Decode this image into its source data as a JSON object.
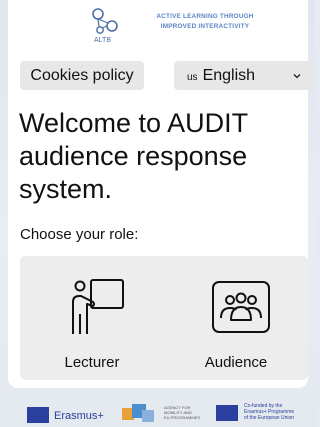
{
  "logo": {
    "alt": "ALTB",
    "tagline": [
      "ACTIVE LEARNING THROUGH",
      "IMPROVED INTERACTIVITY"
    ],
    "accent": "#5b84c4"
  },
  "controls": {
    "cookies_label": "Cookies policy",
    "language": {
      "code": "us",
      "selected": "English"
    }
  },
  "welcome": "Welcome to AUDIT audience response system.",
  "choose_role": "Choose your role:",
  "roles": [
    {
      "label": "Lecturer",
      "icon": "lecturer-board-icon"
    },
    {
      "label": "Audience",
      "icon": "audience-group-icon"
    }
  ],
  "footer": {
    "erasmus": "Erasmus+",
    "agency": [
      "AGENCY FOR",
      "MOBILITY AND",
      "EU PROGRAMMES"
    ],
    "cofunded": [
      "Co-funded by the",
      "Erasmus+ Programme",
      "of the European Union"
    ]
  }
}
